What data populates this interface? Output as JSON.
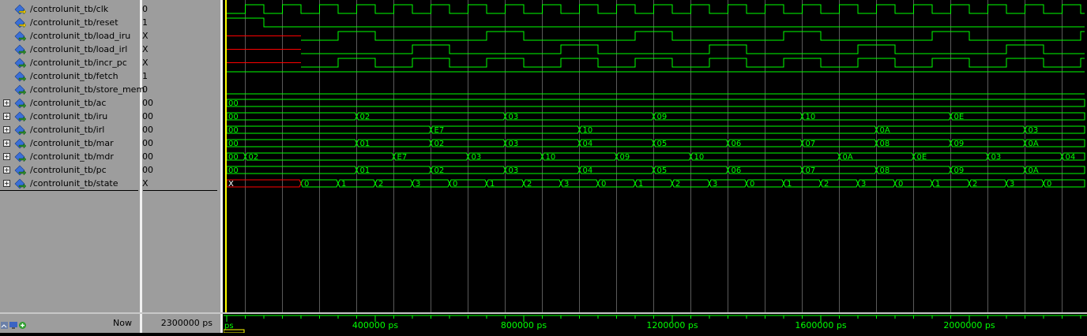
{
  "colors": {
    "wave": "#00ff00",
    "unknown": "#ff0000",
    "grid": "#5a5a5a",
    "cursor": "#ffff00",
    "axis_text": "#00ff00",
    "pane_bg": "#9d9d9d"
  },
  "signals": [
    {
      "name": "/controlunit_tb/clk",
      "value": "0",
      "expandable": false,
      "icon": "signal-in-icon"
    },
    {
      "name": "/controlunit_tb/reset",
      "value": "1",
      "expandable": false,
      "icon": "signal-in-icon"
    },
    {
      "name": "/controlunit_tb/load_iru",
      "value": "X",
      "expandable": false,
      "icon": "signal-out-icon"
    },
    {
      "name": "/controlunit_tb/load_irl",
      "value": "X",
      "expandable": false,
      "icon": "signal-out-icon"
    },
    {
      "name": "/controlunit_tb/incr_pc",
      "value": "X",
      "expandable": false,
      "icon": "signal-out-icon"
    },
    {
      "name": "/controlunit_tb/fetch",
      "value": "1",
      "expandable": false,
      "icon": "signal-out-icon"
    },
    {
      "name": "/controlunit_tb/store_mem",
      "value": "0",
      "expandable": false,
      "icon": "signal-out-icon"
    },
    {
      "name": "/controlunit_tb/ac",
      "value": "00",
      "expandable": true,
      "icon": "signal-bus-icon"
    },
    {
      "name": "/controlunit_tb/iru",
      "value": "00",
      "expandable": true,
      "icon": "signal-bus-icon"
    },
    {
      "name": "/controlunit_tb/irl",
      "value": "00",
      "expandable": true,
      "icon": "signal-bus-icon"
    },
    {
      "name": "/controlunit_tb/mar",
      "value": "00",
      "expandable": true,
      "icon": "signal-bus-icon"
    },
    {
      "name": "/controlunit_tb/mdr",
      "value": "00",
      "expandable": true,
      "icon": "signal-bus-icon"
    },
    {
      "name": "/controlunit_tb/pc",
      "value": "00",
      "expandable": true,
      "icon": "signal-bus-icon"
    },
    {
      "name": "/controlunit_tb/state",
      "value": "X",
      "expandable": true,
      "icon": "signal-bus-icon"
    }
  ],
  "status_bar": {
    "now_label": "Now",
    "now_value": "2300000 ps",
    "icons": [
      "zoom-icon",
      "monitor-icon",
      "add-icon"
    ]
  },
  "timeline": {
    "time_unit": "ps",
    "range_ps": [
      0,
      2320000
    ],
    "start_label": "ps",
    "ticks": [
      {
        "t": 400000,
        "label": "400000 ps"
      },
      {
        "t": 800000,
        "label": "800000 ps"
      },
      {
        "t": 1200000,
        "label": "1200000 ps"
      },
      {
        "t": 1600000,
        "label": "1600000 ps"
      },
      {
        "t": 2000000,
        "label": "2000000 ps"
      }
    ],
    "cursor_ps": 0
  },
  "waves": {
    "clock_period_ps": 100000,
    "clk": {
      "initial": 0,
      "first_rise_ps": 50000
    },
    "reset": {
      "changes": [
        {
          "t": 0,
          "v": 1
        },
        {
          "t": 100000,
          "v": 0
        }
      ]
    },
    "load_iru": {
      "unknown_until_ps": 200000,
      "changes": [
        {
          "t": 200000,
          "v": 0
        },
        {
          "t": 300000,
          "v": 1
        },
        {
          "t": 400000,
          "v": 0
        },
        {
          "t": 700000,
          "v": 1
        },
        {
          "t": 800000,
          "v": 0
        },
        {
          "t": 1100000,
          "v": 1
        },
        {
          "t": 1200000,
          "v": 0
        },
        {
          "t": 1500000,
          "v": 1
        },
        {
          "t": 1600000,
          "v": 0
        },
        {
          "t": 1900000,
          "v": 1
        },
        {
          "t": 2000000,
          "v": 0
        },
        {
          "t": 2300000,
          "v": 1
        }
      ]
    },
    "load_irl": {
      "unknown_until_ps": 200000,
      "changes": [
        {
          "t": 200000,
          "v": 0
        },
        {
          "t": 500000,
          "v": 1
        },
        {
          "t": 600000,
          "v": 0
        },
        {
          "t": 900000,
          "v": 1
        },
        {
          "t": 1000000,
          "v": 0
        },
        {
          "t": 1300000,
          "v": 1
        },
        {
          "t": 1400000,
          "v": 0
        },
        {
          "t": 1700000,
          "v": 1
        },
        {
          "t": 1800000,
          "v": 0
        },
        {
          "t": 2100000,
          "v": 1
        },
        {
          "t": 2200000,
          "v": 0
        }
      ]
    },
    "incr_pc": {
      "unknown_until_ps": 200000,
      "changes": [
        {
          "t": 200000,
          "v": 0
        },
        {
          "t": 300000,
          "v": 1
        },
        {
          "t": 400000,
          "v": 0
        },
        {
          "t": 500000,
          "v": 1
        },
        {
          "t": 600000,
          "v": 0
        },
        {
          "t": 700000,
          "v": 1
        },
        {
          "t": 800000,
          "v": 0
        },
        {
          "t": 900000,
          "v": 1
        },
        {
          "t": 1000000,
          "v": 0
        },
        {
          "t": 1100000,
          "v": 1
        },
        {
          "t": 1200000,
          "v": 0
        },
        {
          "t": 1300000,
          "v": 1
        },
        {
          "t": 1400000,
          "v": 0
        },
        {
          "t": 1500000,
          "v": 1
        },
        {
          "t": 1600000,
          "v": 0
        },
        {
          "t": 1700000,
          "v": 1
        },
        {
          "t": 1800000,
          "v": 0
        },
        {
          "t": 1900000,
          "v": 1
        },
        {
          "t": 2000000,
          "v": 0
        },
        {
          "t": 2100000,
          "v": 1
        },
        {
          "t": 2200000,
          "v": 0
        },
        {
          "t": 2300000,
          "v": 1
        }
      ]
    },
    "fetch": {
      "changes": [
        {
          "t": 0,
          "v": 1
        }
      ]
    },
    "store_mem": {
      "changes": [
        {
          "t": 0,
          "v": 0
        }
      ]
    },
    "ac": [
      {
        "t": 0,
        "v": "00"
      }
    ],
    "iru": [
      {
        "t": 0,
        "v": "00"
      },
      {
        "t": 350000,
        "v": "02"
      },
      {
        "t": 750000,
        "v": "03"
      },
      {
        "t": 1150000,
        "v": "09"
      },
      {
        "t": 1550000,
        "v": "10"
      },
      {
        "t": 1950000,
        "v": "0E"
      }
    ],
    "irl": [
      {
        "t": 0,
        "v": "00"
      },
      {
        "t": 550000,
        "v": "E7"
      },
      {
        "t": 950000,
        "v": "10"
      },
      {
        "t": 1750000,
        "v": "0A"
      },
      {
        "t": 2150000,
        "v": "03"
      }
    ],
    "mar": [
      {
        "t": 0,
        "v": "00"
      },
      {
        "t": 350000,
        "v": "01"
      },
      {
        "t": 550000,
        "v": "02"
      },
      {
        "t": 750000,
        "v": "03"
      },
      {
        "t": 950000,
        "v": "04"
      },
      {
        "t": 1150000,
        "v": "05"
      },
      {
        "t": 1350000,
        "v": "06"
      },
      {
        "t": 1550000,
        "v": "07"
      },
      {
        "t": 1750000,
        "v": "08"
      },
      {
        "t": 1950000,
        "v": "09"
      },
      {
        "t": 2150000,
        "v": "0A"
      }
    ],
    "mdr": [
      {
        "t": 0,
        "v": "00"
      },
      {
        "t": 50000,
        "v": "02"
      },
      {
        "t": 450000,
        "v": "E7"
      },
      {
        "t": 650000,
        "v": "03"
      },
      {
        "t": 850000,
        "v": "10"
      },
      {
        "t": 1050000,
        "v": "09"
      },
      {
        "t": 1250000,
        "v": "10"
      },
      {
        "t": 1650000,
        "v": "0A"
      },
      {
        "t": 1850000,
        "v": "0E"
      },
      {
        "t": 2050000,
        "v": "03"
      },
      {
        "t": 2250000,
        "v": "04"
      }
    ],
    "pc": [
      {
        "t": 0,
        "v": "00"
      },
      {
        "t": 350000,
        "v": "01"
      },
      {
        "t": 550000,
        "v": "02"
      },
      {
        "t": 750000,
        "v": "03"
      },
      {
        "t": 950000,
        "v": "04"
      },
      {
        "t": 1150000,
        "v": "05"
      },
      {
        "t": 1350000,
        "v": "06"
      },
      {
        "t": 1550000,
        "v": "07"
      },
      {
        "t": 1750000,
        "v": "08"
      },
      {
        "t": 1950000,
        "v": "09"
      },
      {
        "t": 2150000,
        "v": "0A"
      }
    ],
    "state": [
      {
        "t": 0,
        "v": "X"
      },
      {
        "t": 200000,
        "v": "0"
      },
      {
        "t": 300000,
        "v": "1"
      },
      {
        "t": 400000,
        "v": "2"
      },
      {
        "t": 500000,
        "v": "3"
      },
      {
        "t": 600000,
        "v": "0"
      },
      {
        "t": 700000,
        "v": "1"
      },
      {
        "t": 800000,
        "v": "2"
      },
      {
        "t": 900000,
        "v": "3"
      },
      {
        "t": 1000000,
        "v": "0"
      },
      {
        "t": 1100000,
        "v": "1"
      },
      {
        "t": 1200000,
        "v": "2"
      },
      {
        "t": 1300000,
        "v": "3"
      },
      {
        "t": 1400000,
        "v": "0"
      },
      {
        "t": 1500000,
        "v": "1"
      },
      {
        "t": 1600000,
        "v": "2"
      },
      {
        "t": 1700000,
        "v": "3"
      },
      {
        "t": 1800000,
        "v": "0"
      },
      {
        "t": 1900000,
        "v": "1"
      },
      {
        "t": 2000000,
        "v": "2"
      },
      {
        "t": 2100000,
        "v": "3"
      },
      {
        "t": 2200000,
        "v": "0"
      }
    ]
  }
}
